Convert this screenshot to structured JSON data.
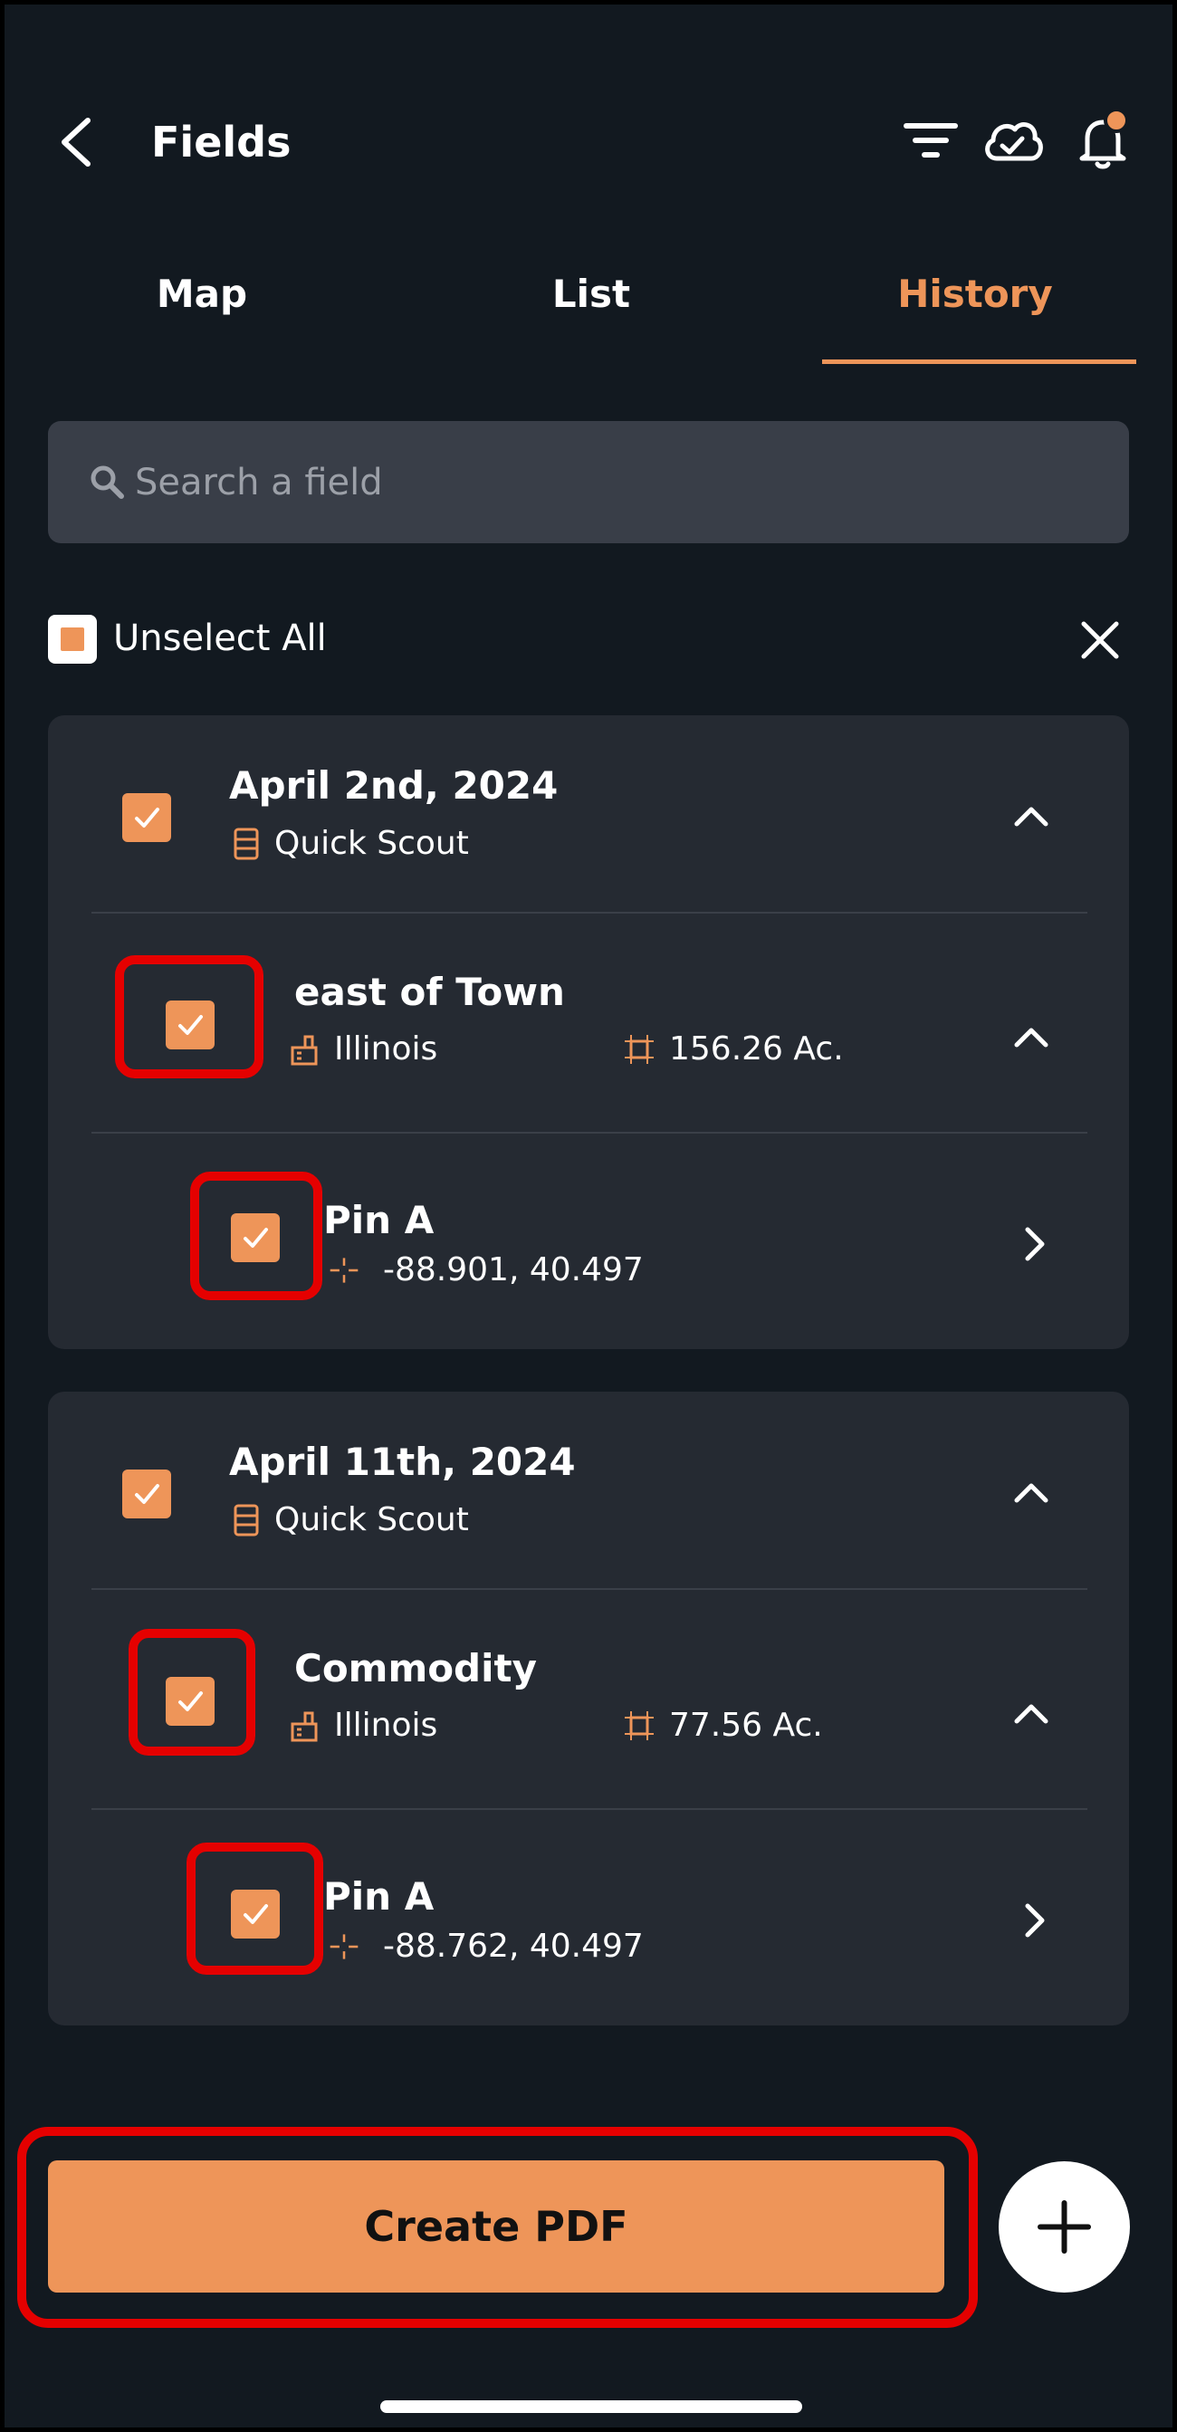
{
  "header": {
    "title": "Fields",
    "icons": [
      "back-icon",
      "filter-icon",
      "cloud-sync-icon",
      "bell-icon"
    ]
  },
  "tabs": [
    {
      "label": "Map",
      "active": false
    },
    {
      "label": "List",
      "active": false
    },
    {
      "label": "History",
      "active": true
    }
  ],
  "search": {
    "placeholder": "Search a field",
    "value": ""
  },
  "selection": {
    "unselect_label": "Unselect All"
  },
  "groups": [
    {
      "date": "April 2nd, 2024",
      "type": "Quick Scout",
      "checked": true,
      "field": {
        "name": "east of Town",
        "state": "Illinois",
        "area": "156.26 Ac.",
        "checked": true
      },
      "pin": {
        "name": "Pin A",
        "coords": "-88.901, 40.497",
        "checked": true
      }
    },
    {
      "date": "April 11th, 2024",
      "type": "Quick Scout",
      "checked": true,
      "field": {
        "name": "Commodity",
        "state": "Illinois",
        "area": "77.56 Ac.",
        "checked": true
      },
      "pin": {
        "name": "Pin A",
        "coords": "-88.762, 40.497",
        "checked": true
      }
    }
  ],
  "footer": {
    "create_pdf_label": "Create PDF",
    "add_icon": "plus-icon"
  },
  "colors": {
    "accent": "#EE9559",
    "background": "#121920",
    "card": "#252A32",
    "highlight": "#E50000"
  }
}
